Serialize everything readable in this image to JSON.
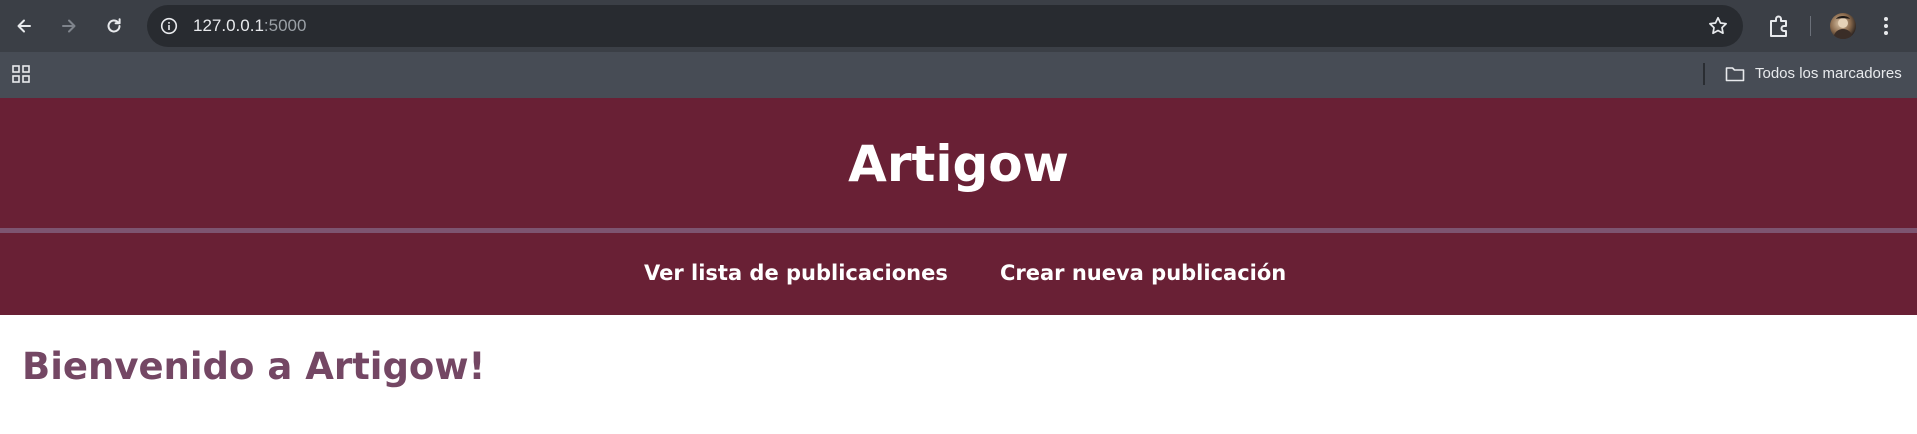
{
  "browser": {
    "url_host": "127.0.0.1",
    "url_port": ":5000",
    "bookmarks_label": "Todos los marcadores"
  },
  "site": {
    "title": "Artigow",
    "nav": [
      {
        "label": "Ver lista de publicaciones"
      },
      {
        "label": "Crear nueva publicación"
      }
    ],
    "welcome": "Bienvenido a Artigow!"
  },
  "colors": {
    "header_bg": "#692035",
    "header_rule": "#7d5470",
    "welcome_text": "#744764",
    "browser_toolbar": "#3b3f46",
    "bookmarks_bar": "#474c55"
  },
  "icons": [
    "back-arrow-icon",
    "forward-arrow-icon",
    "reload-icon",
    "info-icon",
    "star-icon",
    "extensions-icon",
    "avatar",
    "more-vert-icon",
    "apps-grid-icon",
    "folder-icon"
  ]
}
